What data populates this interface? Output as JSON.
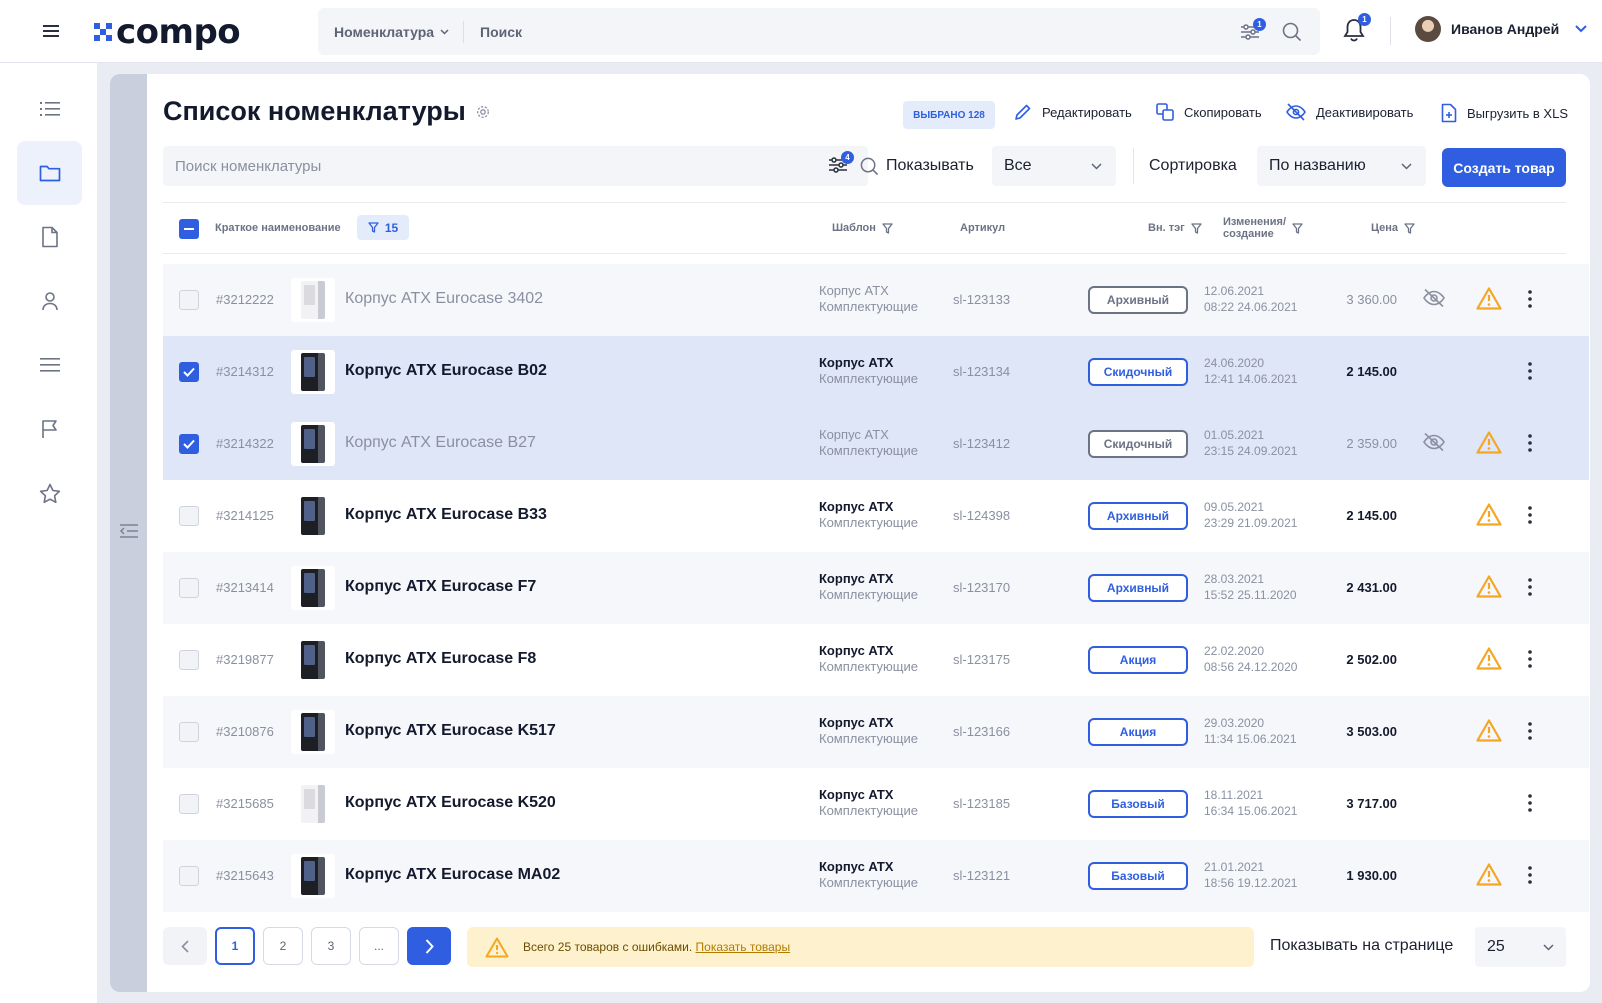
{
  "header": {
    "logo_text": "compo",
    "nom_select": "Номенклатура",
    "search_placeholder": "Поиск",
    "filter_badge": "1",
    "notif_badge": "1",
    "user_name": "Иванов Андрей"
  },
  "sidebar": {
    "items": [
      {
        "icon": "list-icon"
      },
      {
        "icon": "folder-icon",
        "active": true
      },
      {
        "icon": "document-icon"
      },
      {
        "icon": "user-icon"
      },
      {
        "icon": "menu-icon"
      },
      {
        "icon": "flag-icon"
      },
      {
        "icon": "star-icon"
      }
    ]
  },
  "page": {
    "title": "Список номенклатуры",
    "selected_badge": "ВЫБРАНО 128",
    "actions": {
      "edit": "Редактировать",
      "copy": "Скопировать",
      "deactivate": "Деактивировать",
      "export": "Выгрузить в XLS"
    },
    "search_placeholder": "Поиск номенклатуры",
    "filter_count": "4",
    "show_label": "Показывать",
    "show_value": "Все",
    "sort_label": "Сортировка",
    "sort_value": "По названию",
    "create_button": "Создать товар"
  },
  "table": {
    "columns": {
      "name": "Краткое наименование",
      "name_filter_count": "15",
      "template": "Шаблон",
      "article": "Артикул",
      "tag": "Вн. тэг",
      "changed_l1": "Изменения/",
      "changed_l2": "создание",
      "price": "Цена"
    },
    "rows": [
      {
        "id": "#3212222",
        "name": "Корпус ATX Eurocase 3402",
        "tpl": "Корпус ATX",
        "cat": "Комплектующие",
        "art": "sl-123133",
        "tag": "Архивный",
        "d1": "12.06.2021",
        "d2": "08:22 24.06.2021",
        "price": "3 360.00",
        "checked": false,
        "dim": true,
        "eye": true,
        "warn": true,
        "bg": "alt",
        "thumb": "white"
      },
      {
        "id": "#3214312",
        "name": "Корпус ATX Eurocase B02",
        "tpl": "Корпус ATX",
        "cat": "Комплектующие",
        "art": "sl-123134",
        "tag": "Скидочный",
        "d1": "24.06.2020",
        "d2": "12:41 14.06.2021",
        "price": "2 145.00",
        "checked": true,
        "dim": false,
        "eye": false,
        "warn": false,
        "bg": "sel",
        "thumb": "dark"
      },
      {
        "id": "#3214322",
        "name": "Корпус ATX Eurocase B27",
        "tpl": "Корпус ATX",
        "cat": "Комплектующие",
        "art": "sl-123412",
        "tag": "Скидочный",
        "d1": "01.05.2021",
        "d2": "23:15 24.09.2021",
        "price": "2 359.00",
        "checked": true,
        "dim": true,
        "eye": true,
        "warn": true,
        "bg": "sel",
        "thumb": "dark"
      },
      {
        "id": "#3214125",
        "name": "Корпус ATX Eurocase B33",
        "tpl": "Корпус ATX",
        "cat": "Комплектующие",
        "art": "sl-124398",
        "tag": "Архивный",
        "d1": "09.05.2021",
        "d2": "23:29 21.09.2021",
        "price": "2 145.00",
        "checked": false,
        "dim": false,
        "eye": false,
        "warn": true,
        "bg": "",
        "thumb": "dark"
      },
      {
        "id": "#3213414",
        "name": "Корпус ATX Eurocase F7",
        "tpl": "Корпус ATX",
        "cat": "Комплектующие",
        "art": "sl-123170",
        "tag": "Архивный",
        "d1": "28.03.2021",
        "d2": "15:52 25.11.2020",
        "price": "2 431.00",
        "checked": false,
        "dim": false,
        "eye": false,
        "warn": true,
        "bg": "alt",
        "thumb": "dark"
      },
      {
        "id": "#3219877",
        "name": "Корпус ATX Eurocase F8",
        "tpl": "Корпус ATX",
        "cat": "Комплектующие",
        "art": "sl-123175",
        "tag": "Акция",
        "d1": "22.02.2020",
        "d2": "08:56 24.12.2020",
        "price": "2 502.00",
        "checked": false,
        "dim": false,
        "eye": false,
        "warn": true,
        "bg": "",
        "thumb": "dark"
      },
      {
        "id": "#3210876",
        "name": "Корпус ATX Eurocase K517",
        "tpl": "Корпус ATX",
        "cat": "Комплектующие",
        "art": "sl-123166",
        "tag": "Акция",
        "d1": "29.03.2020",
        "d2": "11:34 15.06.2021",
        "price": "3 503.00",
        "checked": false,
        "dim": false,
        "eye": false,
        "warn": true,
        "bg": "alt",
        "thumb": "dark"
      },
      {
        "id": "#3215685",
        "name": "Корпус ATX Eurocase K520",
        "tpl": "Корпус ATX",
        "cat": "Комплектующие",
        "art": "sl-123185",
        "tag": "Базовый",
        "d1": "18.11.2021",
        "d2": "16:34 15.06.2021",
        "price": "3 717.00",
        "checked": false,
        "dim": false,
        "eye": false,
        "warn": false,
        "bg": "",
        "thumb": "white"
      },
      {
        "id": "#3215643",
        "name": "Корпус ATX Eurocase MA02",
        "tpl": "Корпус ATX",
        "cat": "Комплектующие",
        "art": "sl-123121",
        "tag": "Базовый",
        "d1": "21.01.2021",
        "d2": "18:56 19.12.2021",
        "price": "1 930.00",
        "checked": false,
        "dim": false,
        "eye": false,
        "warn": true,
        "bg": "alt",
        "thumb": "dark"
      }
    ]
  },
  "pagination": {
    "pages": [
      "1",
      "2",
      "3",
      "..."
    ],
    "current": "1",
    "alert_text": "Всего 25 товаров с ошибками.",
    "alert_link": "Показать товары",
    "per_page_label": "Показывать на странице",
    "per_page_value": "25"
  },
  "colors": {
    "accent": "#2f5fe0",
    "warning": "#f5a623",
    "selected_row": "#dfe6f8",
    "alert_bg": "#fdf2cd"
  }
}
